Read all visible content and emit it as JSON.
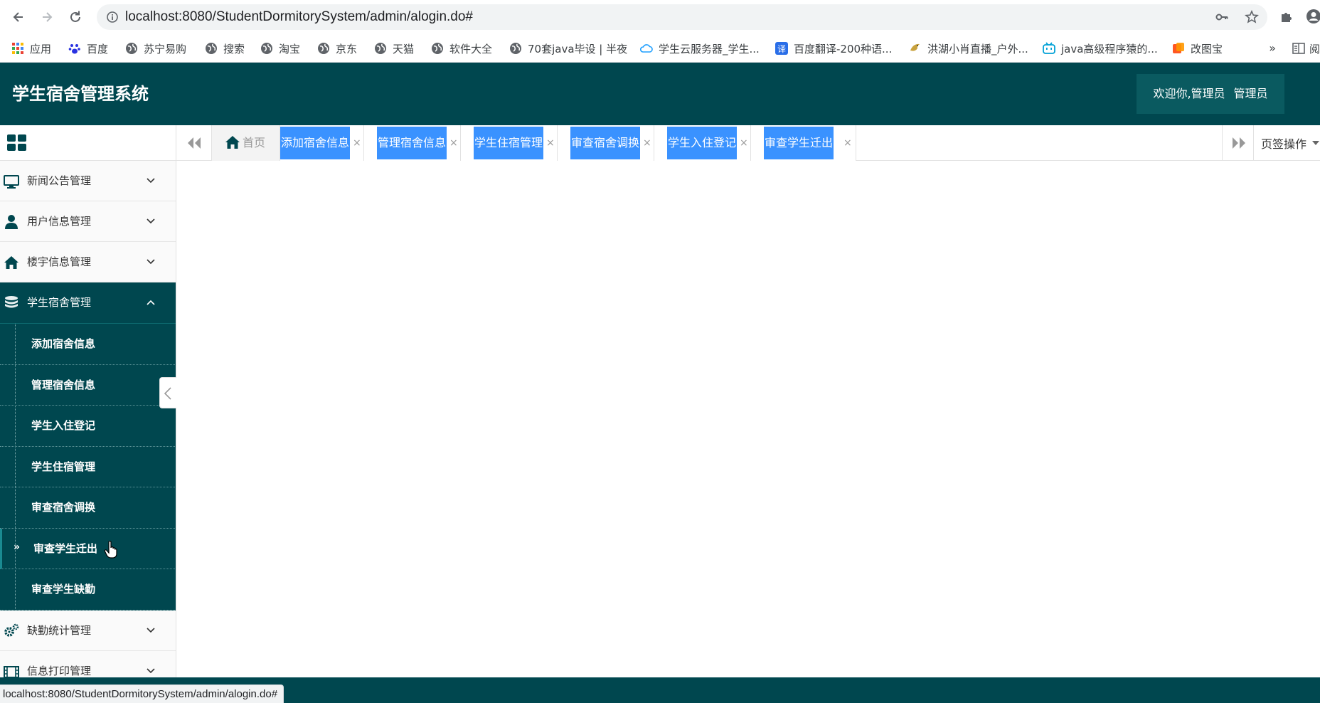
{
  "browser": {
    "url": "localhost:8080/StudentDormitorySystem/admin/alogin.do#",
    "status_url": "localhost:8080/StudentDormitorySystem/admin/alogin.do#",
    "bookmarks": [
      {
        "label": "应用",
        "icon": "apps-grid-icon"
      },
      {
        "label": "百度",
        "icon": "baidu-paw-icon"
      },
      {
        "label": "苏宁易购",
        "icon": "globe-icon"
      },
      {
        "label": "搜索",
        "icon": "globe-icon"
      },
      {
        "label": "淘宝",
        "icon": "globe-icon"
      },
      {
        "label": "京东",
        "icon": "globe-icon"
      },
      {
        "label": "天猫",
        "icon": "globe-icon"
      },
      {
        "label": "软件大全",
        "icon": "globe-icon"
      },
      {
        "label": "70套java毕设 | 半夜",
        "icon": "globe-icon"
      },
      {
        "label": "学生云服务器_学生...",
        "icon": "cloud-icon"
      },
      {
        "label": "百度翻译-200种语...",
        "icon": "translate-icon"
      },
      {
        "label": "洪湖小肖直播_户外...",
        "icon": "bird-icon"
      },
      {
        "label": "java高级程序猿的...",
        "icon": "bilibili-icon"
      },
      {
        "label": "改图宝",
        "icon": "image-edit-icon"
      }
    ],
    "more": "»",
    "reading_list": "阅"
  },
  "header": {
    "title": "学生宿舍管理系统",
    "welcome": "欢迎你,管理员",
    "role": "管理员"
  },
  "sidebar": {
    "menus": [
      {
        "label": "新闻公告管理",
        "icon": "monitor-icon"
      },
      {
        "label": "用户信息管理",
        "icon": "user-icon"
      },
      {
        "label": "楼宇信息管理",
        "icon": "home-icon"
      },
      {
        "label": "学生宿舍管理",
        "icon": "database-icon"
      },
      {
        "label": "缺勤统计管理",
        "icon": "gears-icon"
      },
      {
        "label": "信息打印管理",
        "icon": "film-icon"
      }
    ],
    "submenu": [
      "添加宿舍信息",
      "管理宿舍信息",
      "学生入住登记",
      "学生住宿管理",
      "审查宿舍调换",
      "审查学生迁出",
      "审查学生缺勤"
    ],
    "current_marker": "»"
  },
  "tabs": {
    "home": "首页",
    "items": [
      "添加宿舍信息",
      "管理宿舍信息",
      "学生住宿管理",
      "审查宿舍调换",
      "学生入住登记",
      "审查学生迁出"
    ],
    "close": "×",
    "ops": "页签操作"
  },
  "colors": {
    "primary": "#00474f",
    "tab_active": "#3a92ff",
    "welcome_bg": "#0a5a60"
  }
}
